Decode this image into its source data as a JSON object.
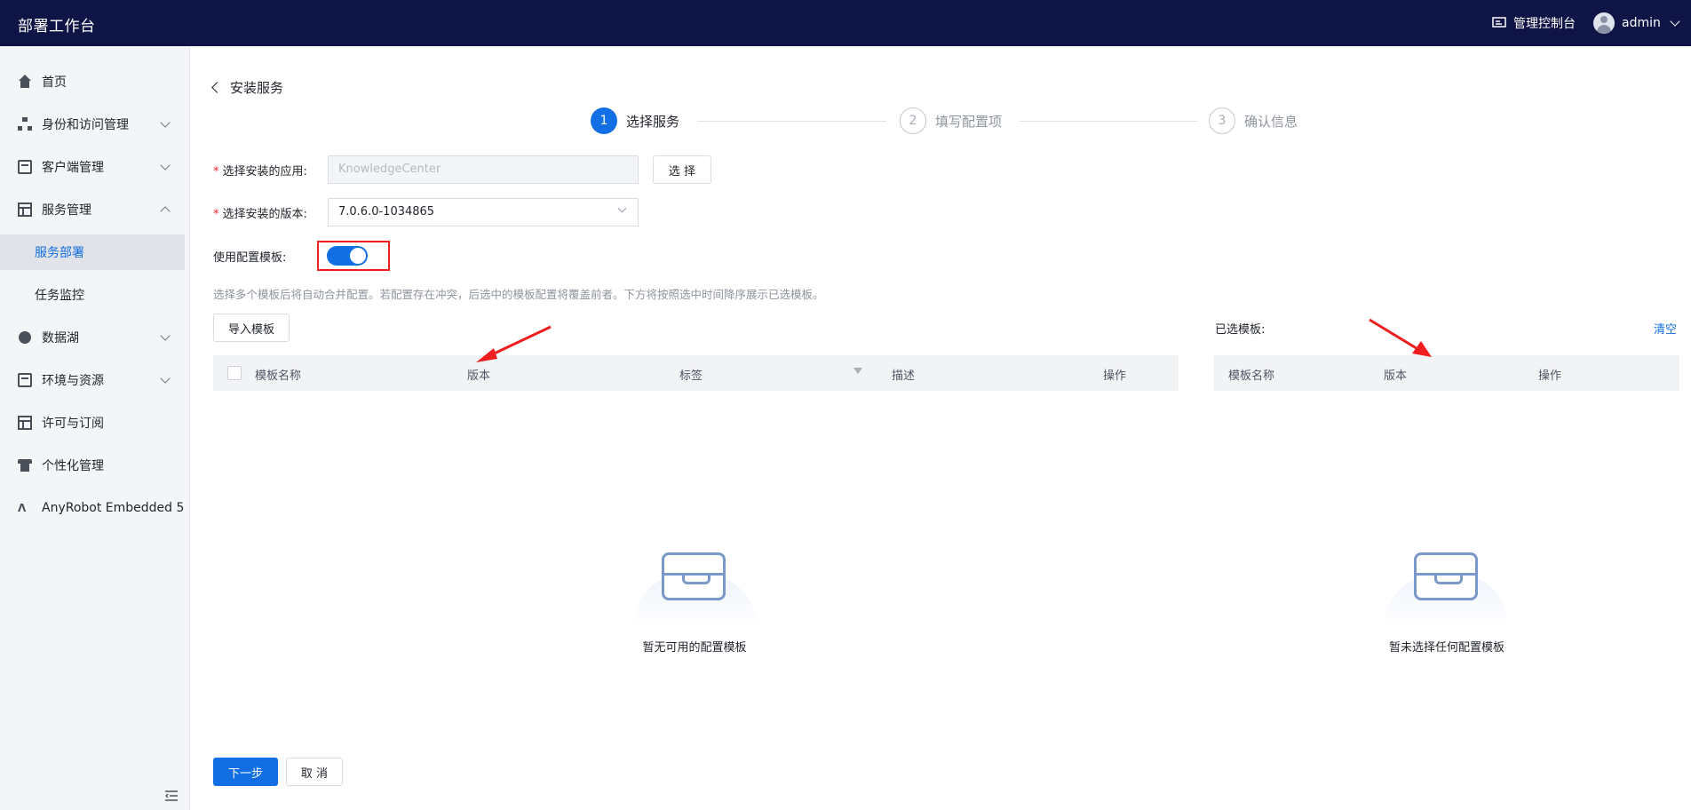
{
  "header": {
    "app_title": "部署工作台",
    "console_label": "管理控制台",
    "user_name": "admin"
  },
  "sidebar": {
    "items": [
      {
        "label": "首页",
        "icon": "home-icon"
      },
      {
        "label": "身份和访问管理",
        "icon": "org-icon",
        "expandable": true
      },
      {
        "label": "客户端管理",
        "icon": "code-window-icon",
        "expandable": true
      },
      {
        "label": "服务管理",
        "icon": "table-icon",
        "expanded": true
      },
      {
        "label": "服务部署",
        "sub": true,
        "active": true
      },
      {
        "label": "任务监控",
        "sub": true
      },
      {
        "label": "数据湖",
        "icon": "datalake-icon",
        "expandable": true
      },
      {
        "label": "环境与资源",
        "icon": "code-window-icon",
        "expandable": true
      },
      {
        "label": "许可与订阅",
        "icon": "license-icon"
      },
      {
        "label": "个性化管理",
        "icon": "shirt-icon"
      },
      {
        "label": "AnyRobot Embedded 5",
        "icon": "anyrobot-icon"
      }
    ]
  },
  "page": {
    "back_title": "安装服务",
    "steps": [
      {
        "num": "1",
        "label": "选择服务",
        "state": "active"
      },
      {
        "num": "2",
        "label": "填写配置项",
        "state": "todo"
      },
      {
        "num": "3",
        "label": "确认信息",
        "state": "todo"
      }
    ],
    "form": {
      "app_label": "选择安装的应用:",
      "app_value": "KnowledgeCenter",
      "select_button": "选 择",
      "version_label": "选择安装的版本:",
      "version_value": "7.0.6.0-1034865",
      "template_toggle_label": "使用配置模板:",
      "template_toggle_on": true
    },
    "hint": "选择多个模板后将自动合并配置。若配置存在冲突，后选中的模板配置将覆盖前者。下方将按照选中时间降序展示已选模板。",
    "import_button": "导入模板",
    "available_table": {
      "columns": [
        "模板名称",
        "版本",
        "标签",
        "描述",
        "操作"
      ],
      "empty_text": "暂无可用的配置模板"
    },
    "selected_panel": {
      "title": "已选模板:",
      "clear_link": "清空",
      "columns": [
        "模板名称",
        "版本",
        "操作"
      ],
      "empty_text": "暂未选择任何配置模板"
    },
    "footer": {
      "next_button": "下一步",
      "cancel_button": "取 消"
    },
    "annotation_color": "#f01e1e",
    "accent_color": "#126ee3"
  }
}
